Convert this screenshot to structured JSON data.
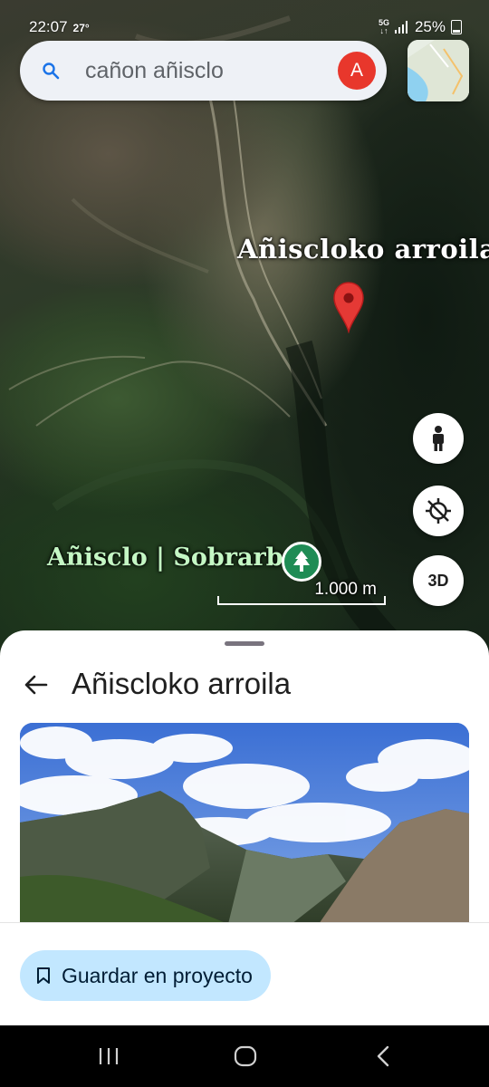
{
  "status_bar": {
    "time": "22:07",
    "temperature": "27°",
    "network_top": "5G",
    "network_bottom": "↓↑",
    "battery": "25%"
  },
  "search": {
    "query": "cañon añisclo",
    "avatar_letter": "A"
  },
  "map": {
    "place_label": "Añiscloko arroila",
    "park_label": "Añisclo | Sobrarbe",
    "scale_label": "1.000 m",
    "three_d_label": "3D"
  },
  "sheet": {
    "title": "Añiscloko arroila",
    "save_button_label": "Guardar en proyecto"
  },
  "colors": {
    "pin": "#e53935",
    "park": "#1f8c55",
    "avatar": "#e8372c",
    "save_button_bg": "#c2e7ff"
  },
  "icons": [
    "search-icon",
    "layers-thumbnail",
    "place-pin-icon",
    "tree-icon",
    "pegman-icon",
    "location-off-icon",
    "back-arrow-icon",
    "bookmark-icon",
    "recent-apps-icon",
    "home-icon",
    "back-icon"
  ]
}
